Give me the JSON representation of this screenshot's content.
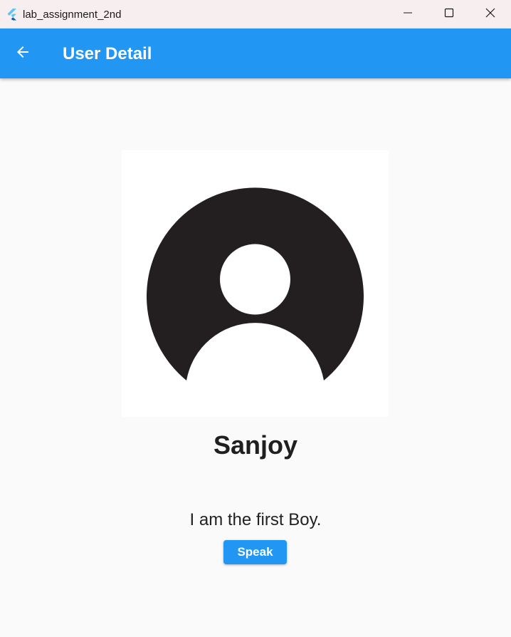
{
  "window": {
    "title": "lab_assignment_2nd",
    "icons": {
      "app": "flutter-icon",
      "minimize": "minimize-icon",
      "maximize": "maximize-icon",
      "close": "close-icon"
    }
  },
  "appbar": {
    "title": "User Detail",
    "back_icon": "arrow-back-icon",
    "color": "#2196f3"
  },
  "user": {
    "avatar_icon": "user-avatar-icon",
    "name": "Sanjoy",
    "description": "I am the first Boy."
  },
  "actions": {
    "speak_label": "Speak"
  }
}
